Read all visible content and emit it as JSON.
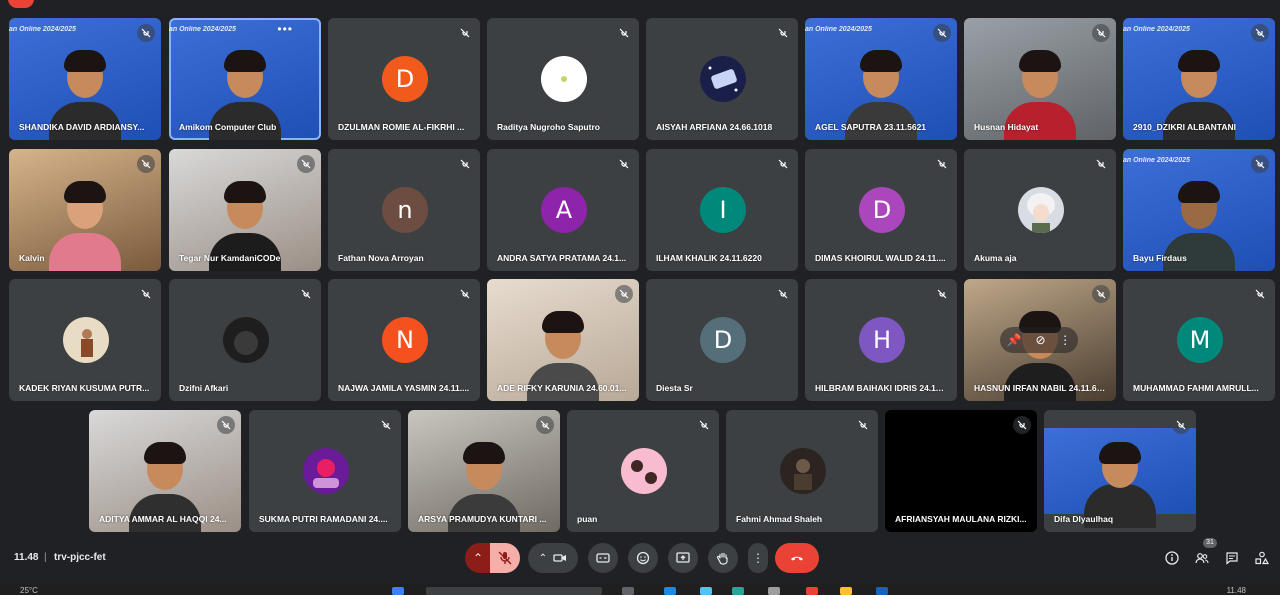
{
  "meeting": {
    "time": "11.48",
    "separator": "|",
    "code": "trv-pjcc-fet",
    "banner_text": "an Online 2024/2025",
    "people_count": "31"
  },
  "participants_row1": [
    {
      "name": "SHANDIKA DAVID ARDIANSY...",
      "kind": "video"
    },
    {
      "name": "Amikom Computer Club",
      "kind": "video"
    },
    {
      "name": "DZULMAN ROMIE AL-FIKRHI ...",
      "kind": "avatar",
      "initial": "D",
      "color": "#f25a1d"
    },
    {
      "name": "Raditya Nugroho Saputro",
      "kind": "avatar-img"
    },
    {
      "name": "AISYAH ARFIANA 24.66.1018",
      "kind": "avatar-img"
    },
    {
      "name": "AGEL SAPUTRA 23.11.5621",
      "kind": "video"
    },
    {
      "name": "Husnan Hidayat",
      "kind": "video"
    },
    {
      "name": "2910_DZIKRI ALBANTANI",
      "kind": "video"
    }
  ],
  "participants_row2": [
    {
      "name": "Kalvin",
      "kind": "video"
    },
    {
      "name": "Tegar Nur KamdaniCODe",
      "kind": "video"
    },
    {
      "name": "Fathan Nova Arroyan",
      "kind": "avatar",
      "initial": "n",
      "color": "#6d4c41"
    },
    {
      "name": "ANDRA SATYA PRATAMA 24.1...",
      "kind": "avatar",
      "initial": "A",
      "color": "#8e24aa"
    },
    {
      "name": "ILHAM KHALIK 24.11.6220",
      "kind": "avatar",
      "initial": "I",
      "color": "#00897b"
    },
    {
      "name": "DIMAS KHOIRUL WALID 24.11....",
      "kind": "avatar",
      "initial": "D",
      "color": "#ab47bc"
    },
    {
      "name": "Akuma aja",
      "kind": "avatar-img"
    },
    {
      "name": "Bayu Firdaus",
      "kind": "video"
    }
  ],
  "participants_row3": [
    {
      "name": "KADEK RIYAN KUSUMA PUTR...",
      "kind": "avatar-img"
    },
    {
      "name": "Dzifni Afkari",
      "kind": "avatar-img"
    },
    {
      "name": "NAJWA JAMILA YASMIN 24.11....",
      "kind": "avatar",
      "initial": "N",
      "color": "#f4511e"
    },
    {
      "name": "ADE RIFKY KARUNIA 24.60.01...",
      "kind": "video"
    },
    {
      "name": "Diesta Sr",
      "kind": "avatar",
      "initial": "D",
      "color": "#546e7a"
    },
    {
      "name": "HILBRAM BAIHAKI IDRIS 24.11....",
      "kind": "avatar",
      "initial": "H",
      "color": "#7e57c2"
    },
    {
      "name": "HASNUN IRFAN NABIL 24.11.61...",
      "kind": "video"
    },
    {
      "name": "MUHAMMAD FAHMI AMRULL...",
      "kind": "avatar",
      "initial": "M",
      "color": "#00897b"
    }
  ],
  "participants_row4": [
    {
      "name": "ADITYA AMMAR AL HAQQI 24...",
      "kind": "video"
    },
    {
      "name": "SUKMA PUTRI RAMADANI 24....",
      "kind": "avatar-img"
    },
    {
      "name": "ARSYA PRAMUDYA KUNTARI ...",
      "kind": "video"
    },
    {
      "name": "puan",
      "kind": "avatar-img"
    },
    {
      "name": "Fahmi Ahmad Shaleh",
      "kind": "avatar-img"
    },
    {
      "name": "AFRIANSYAH MAULANA RIZKI...",
      "kind": "black"
    },
    {
      "name": "Difa Dlyaulhaq",
      "kind": "video"
    }
  ],
  "taskbar": {
    "weather": "25°C",
    "clock": "11.48"
  },
  "colors": {
    "background": "#202124",
    "tile": "#3c4043",
    "end_call": "#ea4335"
  }
}
